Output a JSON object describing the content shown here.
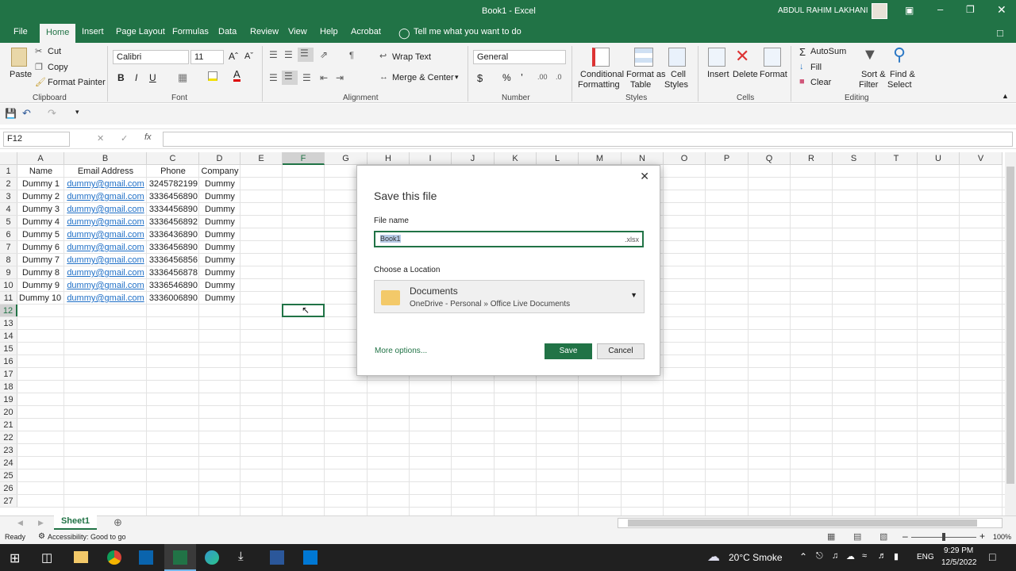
{
  "window": {
    "title": "Book1 - Excel",
    "user": "ABDUL RAHIM LAKHANI"
  },
  "tabs": [
    "File",
    "Home",
    "Insert",
    "Page Layout",
    "Formulas",
    "Data",
    "Review",
    "View",
    "Help",
    "Acrobat"
  ],
  "tell_me": "Tell me what you want to do",
  "ribbon": {
    "clipboard": {
      "paste": "Paste",
      "cut": "Cut",
      "copy": "Copy",
      "format_painter": "Format Painter",
      "group": "Clipboard"
    },
    "font": {
      "name": "Calibri",
      "size": "11",
      "bold": "B",
      "italic": "I",
      "underline": "U",
      "group": "Font"
    },
    "alignment": {
      "wrap": "Wrap Text",
      "merge": "Merge & Center",
      "group": "Alignment"
    },
    "number": {
      "format": "General",
      "currency": "$",
      "percent": "%",
      "comma": "’",
      "group": "Number"
    },
    "styles": {
      "conditional": "Conditional",
      "conditional2": "Formatting",
      "format_as": "Format as",
      "format_as2": "Table",
      "cell": "Cell",
      "cell2": "Styles",
      "group": "Styles"
    },
    "cells": {
      "insert": "Insert",
      "delete": "Delete",
      "format": "Format",
      "group": "Cells"
    },
    "editing": {
      "autosum": "AutoSum",
      "fill": "Fill",
      "clear": "Clear",
      "sort": "Sort &",
      "sort2": "Filter",
      "find": "Find &",
      "find2": "Select",
      "group": "Editing"
    }
  },
  "name_box": "F12",
  "fx": "fx",
  "columns": [
    "A",
    "B",
    "C",
    "D",
    "E",
    "F",
    "G",
    "H",
    "I",
    "J",
    "K",
    "L",
    "M",
    "N",
    "O",
    "P",
    "Q",
    "R",
    "S",
    "T",
    "U",
    "V"
  ],
  "rows": [
    "1",
    "2",
    "3",
    "4",
    "5",
    "6",
    "7",
    "8",
    "9",
    "10",
    "11",
    "12",
    "13",
    "14",
    "15",
    "16",
    "17",
    "18",
    "19",
    "20",
    "21",
    "22",
    "23",
    "24",
    "25",
    "26",
    "27"
  ],
  "headers": [
    "Name",
    "Email Address",
    "Phone",
    "Company"
  ],
  "records": [
    [
      "Dummy 1",
      "dummy@gmail.com",
      "3245782199",
      "Dummy"
    ],
    [
      "Dummy 2",
      "dummy@gmail.com",
      "3336456890",
      "Dummy"
    ],
    [
      "Dummy 3",
      "dummy@gmail.com",
      "3334456890",
      "Dummy"
    ],
    [
      "Dummy 4",
      "dummy@gmail.com",
      "3336456892",
      "Dummy"
    ],
    [
      "Dummy 5",
      "dummy@gmail.com",
      "3336436890",
      "Dummy"
    ],
    [
      "Dummy 6",
      "dummy@gmail.com",
      "3336456890",
      "Dummy"
    ],
    [
      "Dummy 7",
      "dummy@gmail.com",
      "3336456856",
      "Dummy"
    ],
    [
      "Dummy 8",
      "dummy@gmail.com",
      "3336456878",
      "Dummy"
    ],
    [
      "Dummy 9",
      "dummy@gmail.com",
      "3336546890",
      "Dummy"
    ],
    [
      "Dummy 10",
      "dummy@gmail.com",
      "3336006890",
      "Dummy"
    ]
  ],
  "dialog": {
    "title": "Save this file",
    "file_name_label": "File name",
    "file_name": "Book1",
    "extension": ".xlsx",
    "location_label": "Choose a Location",
    "location_name": "Documents",
    "location_path": "OneDrive - Personal » Office Live Documents",
    "more_options": "More options...",
    "save": "Save",
    "cancel": "Cancel"
  },
  "sheet_tab": "Sheet1",
  "status": {
    "ready": "Ready",
    "accessibility": "Accessibility: Good to go",
    "zoom": "100%"
  },
  "taskbar": {
    "weather": "20°C  Smoke",
    "lang": "ENG",
    "time": "9:29 PM",
    "date": "12/5/2022"
  },
  "colors": {
    "excel_green": "#217346",
    "link": "#1e6fc7",
    "selection": "#217346"
  }
}
